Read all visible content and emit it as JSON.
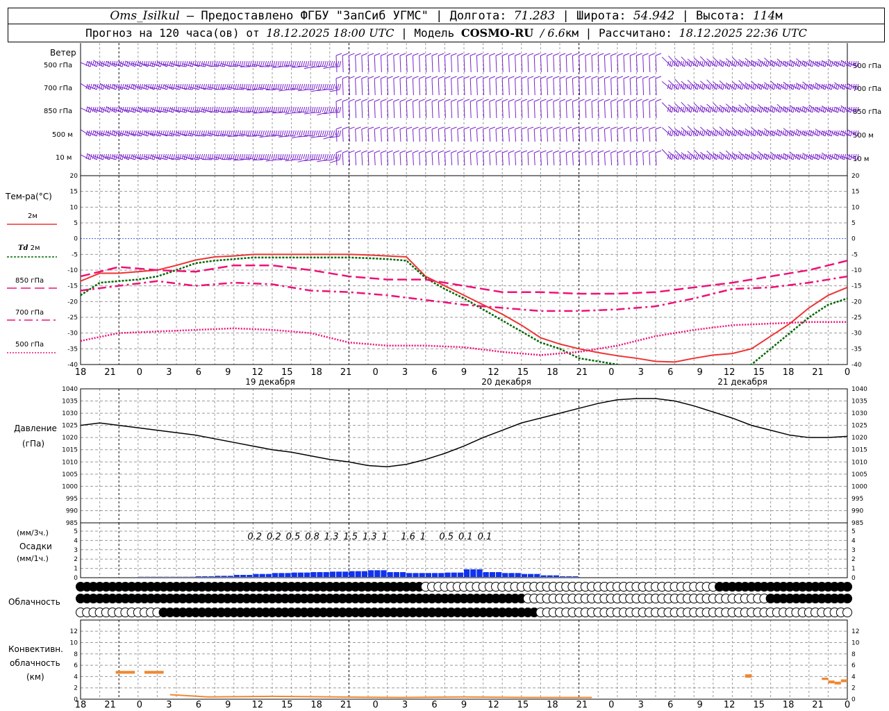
{
  "header": {
    "station": "Oms_Isilkul",
    "provider": "– Предоставлено ФГБУ \"ЗапСиб УГМС\"",
    "lon_label": "Долгота:",
    "lon_value": "71.283",
    "lat_label": "Широта:",
    "lat_value": "54.942",
    "alt_label": "Высота:",
    "alt_value": "114",
    "alt_unit": "м",
    "forecast_prefix": "Прогноз на 120 часа(ов) от",
    "forecast_time": "18.12.2025 18:00 UTC",
    "model_label": "Модель",
    "model_name": "COSMO-RU",
    "model_res": "/ 6.6",
    "model_res_unit": "км",
    "calc_label": "Рассчитано:",
    "calc_time": "18.12.2025 22:36 UTC"
  },
  "labels": {
    "wind": "Ветер",
    "wind_levels": [
      "500 гПа",
      "700 гПа",
      "850 гПа",
      "500 м",
      "10   м"
    ],
    "temp": "Тем-ра(°C)",
    "t2m": "2м",
    "td": "Td",
    "td2": "2м",
    "t850": "850 гПа",
    "t700": "700 гПа",
    "t500": "500 гПа",
    "pressure": "Давление",
    "pressure_unit": "(гПа)",
    "precip_top": "(мм/3ч.)",
    "precip_mid": "Осадки",
    "precip_bot": "(мм/1ч.)",
    "cloud": "Облачность",
    "conv1": "Конвективн.",
    "conv2": "облачность",
    "conv3": "(км)"
  },
  "x_ticks": [
    "18",
    "21",
    "0",
    "3",
    "6",
    "9",
    "12",
    "15",
    "18",
    "21",
    "0",
    "3",
    "6",
    "9",
    "12",
    "15",
    "18",
    "21",
    "0",
    "3",
    "6",
    "9",
    "12",
    "15",
    "18",
    "21",
    "0"
  ],
  "days": [
    "19 декабря",
    "20 декабря",
    "21 декабря"
  ],
  "precip_3h_labels": [
    {
      "h": 42,
      "v": "0.2"
    },
    {
      "h": 45,
      "v": "0.2"
    },
    {
      "h": 48,
      "v": "0.5"
    },
    {
      "h": 51,
      "v": "0.8"
    },
    {
      "h": 54,
      "v": "1.3"
    },
    {
      "h": 57,
      "v": "1.5"
    },
    {
      "h": 60,
      "v": "1.3"
    },
    {
      "h": 63,
      "v": "1"
    },
    {
      "h": 66,
      "v": "1.6"
    },
    {
      "h": 69,
      "v": "1"
    },
    {
      "h": 72,
      "v": "0.5"
    },
    {
      "h": 75,
      "v": "0.1"
    },
    {
      "h": 78,
      "v": "0.1"
    }
  ],
  "colors": {
    "t2m": "#ee3333",
    "td": "#006600",
    "t850": "#ee1177",
    "t700": "#ee1177",
    "t500": "#ee1177",
    "wind": "#7722cc",
    "precip": "#1133ee",
    "conv": "#ee8833",
    "zero": "#3355ee",
    "grid": "#999999"
  },
  "chart_data": [
    {
      "type": "line",
      "title": "Тем-ра(°C)",
      "x_unit": "hours from 18.12.2025 18:00 UTC",
      "ylim": [
        -40,
        20
      ],
      "series": [
        {
          "name": "2м",
          "x": [
            0,
            3,
            6,
            9,
            12,
            15,
            18,
            21,
            24,
            27,
            30,
            33,
            36,
            39,
            42,
            45,
            48,
            51,
            54,
            57,
            60,
            63,
            66,
            69,
            72,
            75,
            78,
            81,
            84,
            87,
            90,
            93,
            96,
            99,
            102,
            105,
            108,
            111,
            114,
            117,
            120
          ],
          "values": [
            -13.5,
            -11,
            -11,
            -10.5,
            -10,
            -8.5,
            -6.8,
            -5.8,
            -5.5,
            -5,
            -5,
            -5,
            -5,
            -5,
            -5,
            -5.2,
            -5.5,
            -5.8,
            -12,
            -15,
            -18,
            -21,
            -24,
            -27.5,
            -31.5,
            -33.5,
            -35,
            -36.2,
            -37.2,
            -38,
            -39,
            -39.2,
            -38,
            -37,
            -36.5,
            -35,
            -31,
            -27,
            -22,
            -18,
            -15.5
          ]
        },
        {
          "name": "Td 2м",
          "x": [
            0,
            3,
            6,
            9,
            12,
            15,
            18,
            21,
            24,
            27,
            30,
            33,
            36,
            39,
            42,
            45,
            48,
            51,
            54,
            57,
            60,
            63,
            66,
            69,
            72,
            75,
            78,
            81,
            84,
            87,
            90,
            93,
            96,
            99,
            102,
            105,
            108,
            111,
            114,
            117,
            120
          ],
          "values": [
            -18,
            -14,
            -13.5,
            -13,
            -12,
            -10,
            -7.8,
            -7,
            -6.5,
            -6,
            -6,
            -6,
            -6,
            -6,
            -6,
            -6.2,
            -6.5,
            -7,
            -12.5,
            -16,
            -19,
            -22.5,
            -26,
            -29.5,
            -33,
            -35,
            -38,
            -39,
            -40,
            -41,
            -42,
            -42.5,
            -42,
            -42,
            -41.5,
            -40,
            -35,
            -30,
            -25,
            -21,
            -19
          ]
        },
        {
          "name": "850 гПа",
          "x": [
            0,
            6,
            12,
            18,
            24,
            30,
            36,
            42,
            48,
            54,
            60,
            66,
            72,
            78,
            84,
            90,
            96,
            102,
            108,
            114,
            120
          ],
          "values": [
            -12,
            -9,
            -10,
            -10.5,
            -8.5,
            -8.5,
            -10,
            -12,
            -13,
            -13,
            -15,
            -17,
            -17,
            -17.5,
            -17.5,
            -17,
            -15.5,
            -14,
            -12,
            -10,
            -7
          ]
        },
        {
          "name": "700 гПа",
          "x": [
            0,
            6,
            12,
            18,
            24,
            30,
            36,
            42,
            48,
            54,
            60,
            66,
            72,
            78,
            84,
            90,
            96,
            102,
            108,
            114,
            120
          ],
          "values": [
            -16.5,
            -15,
            -13.5,
            -15,
            -14,
            -14.5,
            -16.5,
            -17,
            -18,
            -19.5,
            -21,
            -22,
            -23,
            -23,
            -22.5,
            -21.5,
            -19,
            -16,
            -15.5,
            -14,
            -12
          ]
        },
        {
          "name": "500 гПа",
          "x": [
            0,
            6,
            12,
            18,
            24,
            30,
            36,
            42,
            48,
            54,
            60,
            66,
            72,
            78,
            84,
            90,
            96,
            102,
            108,
            114,
            120
          ],
          "values": [
            -32.5,
            -30,
            -29.5,
            -29,
            -28.5,
            -29,
            -30,
            -33,
            -34,
            -34,
            -34.5,
            -36,
            -37,
            -36,
            -34,
            -31,
            -29,
            -27.5,
            -27,
            -26.5,
            -26.5
          ]
        }
      ]
    },
    {
      "type": "line",
      "title": "Давление",
      "ylabel": "(гПа)",
      "x_unit": "hours from 18.12.2025 18:00 UTC",
      "ylim": [
        985,
        1040
      ],
      "series": [
        {
          "name": "Давление",
          "x": [
            0,
            3,
            6,
            9,
            12,
            15,
            18,
            21,
            24,
            27,
            30,
            33,
            36,
            39,
            42,
            45,
            48,
            51,
            54,
            57,
            60,
            63,
            66,
            69,
            72,
            75,
            78,
            81,
            84,
            87,
            90,
            93,
            96,
            99,
            102,
            105,
            108,
            111,
            114,
            117,
            120
          ],
          "values": [
            1025,
            1026,
            1025,
            1024,
            1023,
            1022,
            1021,
            1019.5,
            1018,
            1016.5,
            1015,
            1014,
            1012.5,
            1011,
            1010,
            1008.5,
            1008,
            1009,
            1011,
            1013.5,
            1016.5,
            1020,
            1023,
            1026,
            1028,
            1030,
            1032,
            1034,
            1035.5,
            1036,
            1036,
            1035,
            1033,
            1030.5,
            1028,
            1025,
            1023,
            1021,
            1020,
            1020,
            1020.5
          ]
        }
      ]
    },
    {
      "type": "bar",
      "title": "Осадки",
      "ylabel": "(мм/1ч.)",
      "x_unit": "hours from 18.12.2025 18:00 UTC",
      "ylim": [
        0,
        5
      ],
      "x": [
        9,
        12,
        15,
        18,
        21,
        24,
        27,
        30,
        33,
        36,
        39,
        42,
        45,
        48,
        51,
        54,
        57,
        60,
        63,
        66,
        69,
        72,
        75,
        78,
        81
      ],
      "values": [
        0.1,
        0.1,
        0.1,
        0.15,
        0.2,
        0.3,
        0.4,
        0.5,
        0.55,
        0.6,
        0.65,
        0.7,
        0.8,
        0.6,
        0.5,
        0.5,
        0.55,
        0.9,
        0.6,
        0.5,
        0.4,
        0.25,
        0.15,
        0.05,
        0.02
      ]
    },
    {
      "type": "bar",
      "title": "Конвективн. облачность",
      "ylabel": "(км)",
      "x_unit": "hours from 18.12.2025 18:00 UTC",
      "ylim": [
        0,
        13
      ],
      "segments": [
        {
          "x0": 5.5,
          "x1": 8.5,
          "base": 4.5,
          "top": 5.0
        },
        {
          "x0": 10,
          "x1": 13,
          "base": 4.5,
          "top": 5.0
        },
        {
          "x0": 104,
          "x1": 105,
          "base": 3.8,
          "top": 4.4
        },
        {
          "x0": 116,
          "x1": 117,
          "base": 3.4,
          "top": 3.8
        },
        {
          "x0": 117,
          "x1": 118,
          "base": 2.8,
          "top": 3.3
        },
        {
          "x0": 118,
          "x1": 119,
          "base": 2.6,
          "top": 3.1
        },
        {
          "x0": 119,
          "x1": 120,
          "base": 3.0,
          "top": 3.5
        }
      ],
      "low_line": {
        "x": [
          14,
          20,
          30,
          40,
          50,
          60,
          70,
          80
        ],
        "values": [
          0.8,
          0.4,
          0.5,
          0.4,
          0.3,
          0.4,
          0.3,
          0.3
        ]
      }
    }
  ]
}
